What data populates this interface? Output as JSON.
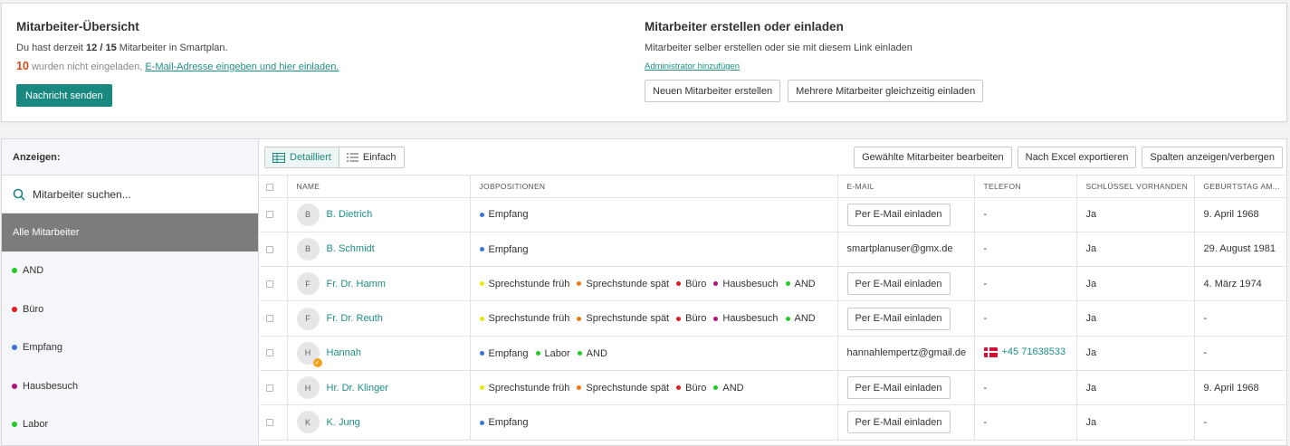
{
  "overview": {
    "title": "Mitarbeiter-Übersicht",
    "line1_prefix": "Du hast derzeit",
    "count": "12 / 15",
    "line1_suffix": "Mitarbeiter in Smartplan.",
    "uninvited_count": "10",
    "uninvited_text": "wurden nicht eingeladen,",
    "invite_link": "E-Mail-Adresse eingeben und hier einladen.",
    "send_button": "Nachricht senden"
  },
  "create": {
    "title": "Mitarbeiter erstellen oder einladen",
    "subtitle": "Mitarbeiter selber erstellen oder sie mit diesem Link einladen",
    "admin_link": "Administrator hinzufügen",
    "new_button": "Neuen Mitarbeiter erstellen",
    "bulk_button": "Mehrere Mitarbeiter gleichzeitig einladen"
  },
  "sidebar": {
    "show_label": "Anzeigen:",
    "search_placeholder": "Mitarbeiter suchen...",
    "all_label": "Alle Mitarbeiter",
    "groups": [
      {
        "label": "AND",
        "color": "#22cc22"
      },
      {
        "label": "Büro",
        "color": "#e01b1b"
      },
      {
        "label": "Empfang",
        "color": "#3b6fe0"
      },
      {
        "label": "Hausbesuch",
        "color": "#b3127a"
      },
      {
        "label": "Labor",
        "color": "#22cc22"
      }
    ]
  },
  "toolbar": {
    "detailed": "Detailliert",
    "simple": "Einfach",
    "edit_selected": "Gewählte Mitarbeiter bearbeiten",
    "export_excel": "Nach Excel exportieren",
    "toggle_columns": "Spalten anzeigen/verbergen"
  },
  "table": {
    "headers": [
      "NAME",
      "JOBPOSITIONEN",
      "E-MAIL",
      "TELEFON",
      "SCHLÜSSEL VORHANDEN",
      "GEBURTSTAG AM..."
    ],
    "rows": [
      {
        "initial": "B",
        "name": "B. Dietrich",
        "jobs": [
          {
            "label": "Empfang",
            "color": "#3b6fe0"
          }
        ],
        "email_button": "Per E-Mail einladen",
        "email": "",
        "phone": "-",
        "key": "Ja",
        "birthday": "9. April 1968"
      },
      {
        "initial": "B",
        "name": "B. Schmidt",
        "jobs": [
          {
            "label": "Empfang",
            "color": "#3b6fe0"
          }
        ],
        "email_button": "",
        "email": "smartplanuser@gmx.de",
        "phone": "-",
        "key": "Ja",
        "birthday": "29. August 1981"
      },
      {
        "initial": "F",
        "name": "Fr. Dr. Hamm",
        "jobs": [
          {
            "label": "Sprechstunde früh",
            "color": "#e8e80c"
          },
          {
            "label": "Sprechstunde spät",
            "color": "#f07814"
          },
          {
            "label": "Büro",
            "color": "#e01b1b"
          },
          {
            "label": "Hausbesuch",
            "color": "#b3127a"
          },
          {
            "label": "AND",
            "color": "#22cc22"
          }
        ],
        "email_button": "Per E-Mail einladen",
        "email": "",
        "phone": "-",
        "key": "Ja",
        "birthday": "4. März 1974"
      },
      {
        "initial": "F",
        "name": "Fr. Dr. Reuth",
        "jobs": [
          {
            "label": "Sprechstunde früh",
            "color": "#e8e80c"
          },
          {
            "label": "Sprechstunde spät",
            "color": "#f07814"
          },
          {
            "label": "Büro",
            "color": "#e01b1b"
          },
          {
            "label": "Hausbesuch",
            "color": "#b3127a"
          },
          {
            "label": "AND",
            "color": "#22cc22"
          }
        ],
        "email_button": "Per E-Mail einladen",
        "email": "",
        "phone": "-",
        "key": "Ja",
        "birthday": "-"
      },
      {
        "initial": "H",
        "name": "Hannah",
        "badge": true,
        "jobs": [
          {
            "label": "Empfang",
            "color": "#3b6fe0"
          },
          {
            "label": "Labor",
            "color": "#22cc22"
          },
          {
            "label": "AND",
            "color": "#22cc22"
          }
        ],
        "email_button": "",
        "email": "hannahlempertz@gmail.de",
        "phone": "+45 71638533",
        "phone_flag": true,
        "key": "Ja",
        "birthday": "-"
      },
      {
        "initial": "H",
        "name": "Hr. Dr. Klinger",
        "jobs": [
          {
            "label": "Sprechstunde früh",
            "color": "#e8e80c"
          },
          {
            "label": "Sprechstunde spät",
            "color": "#f07814"
          },
          {
            "label": "Büro",
            "color": "#e01b1b"
          },
          {
            "label": "AND",
            "color": "#22cc22"
          }
        ],
        "email_button": "Per E-Mail einladen",
        "email": "",
        "phone": "-",
        "key": "Ja",
        "birthday": "9. April 1968"
      },
      {
        "initial": "K",
        "name": "K. Jung",
        "jobs": [
          {
            "label": "Empfang",
            "color": "#3b6fe0"
          }
        ],
        "email_button": "Per E-Mail einladen",
        "email": "",
        "phone": "-",
        "key": "Ja",
        "birthday": "-"
      }
    ]
  }
}
